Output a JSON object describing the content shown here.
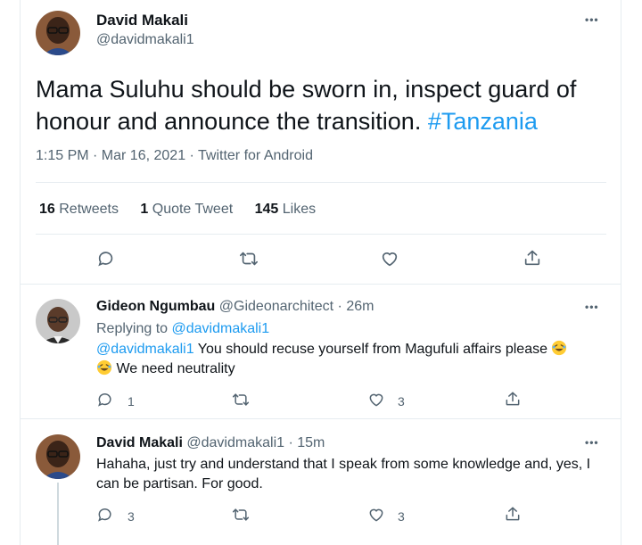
{
  "main_tweet": {
    "author_name": "David Makali",
    "author_handle": "@davidmakali1",
    "text": "Mama Suluhu should be sworn in, inspect guard of honour and announce the transition. ",
    "hashtag": "#Tanzania",
    "timestamp": "1:15 PM · Mar 16, 2021 · Twitter for Android",
    "retweets": {
      "count": "16",
      "label": " Retweets"
    },
    "quote_tweets": {
      "count": "1",
      "label": " Quote Tweet"
    },
    "likes": {
      "count": "145",
      "label": " Likes"
    },
    "more_label": "•••"
  },
  "replies": [
    {
      "author_name": "Gideon Ngumbau",
      "author_handle": "@Gideonarchitect",
      "time": " · 26m",
      "replying_prefix": "Replying to ",
      "replying_to": "@davidmakali1",
      "mention": "@davidmakali1",
      "text_part1": " You should recuse yourself from Magufuli affairs please ",
      "text_part2": " We need neutrality",
      "reply_count": "1",
      "retweet_count": "",
      "like_count": "3",
      "more_label": "•••"
    },
    {
      "author_name": "David Makali",
      "author_handle": "@davidmakali1",
      "time": " · 15m",
      "text": "Hahaha, just try and understand that I speak from some knowledge and, yes, I can be partisan. For good.",
      "reply_count": "3",
      "retweet_count": "",
      "like_count": "3",
      "more_label": "•••"
    }
  ],
  "icons": [
    "reply-icon",
    "retweet-icon",
    "like-icon",
    "share-icon",
    "more-icon",
    "laughing-emoji-icon"
  ],
  "colors": {
    "link": "#1d9bf0",
    "secondary_text": "#536471",
    "divider": "#e6ecf0",
    "text": "#0f1419"
  }
}
